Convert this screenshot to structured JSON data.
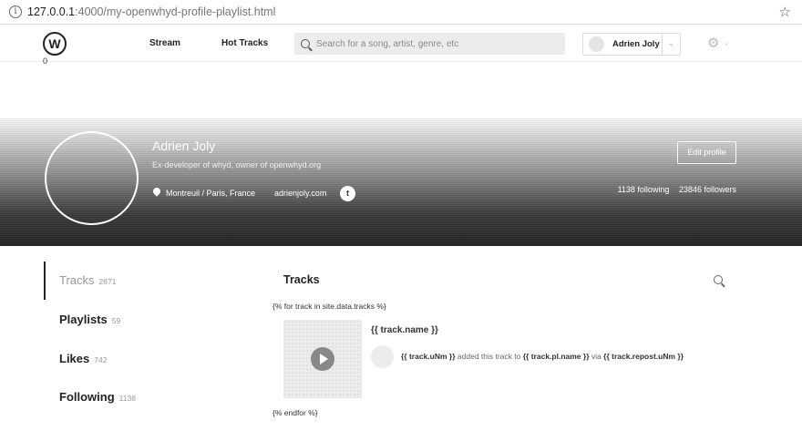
{
  "browser": {
    "info_icon": "i",
    "url_host": "127.0.0.1",
    "url_rest": ":4000/my-openwhyd-profile-playlist.html",
    "star_icon": "star-icon"
  },
  "header": {
    "logo_letter": "W",
    "logo_count": "0",
    "nav": {
      "stream": "Stream",
      "hot_tracks": "Hot Tracks"
    },
    "search_placeholder": "Search for a song, artist, genre, etc",
    "user_name": "Adrien Joly"
  },
  "profile": {
    "name": "Adrien Joly",
    "bio": "Ex-developer of whyd, owner of openwhyd.org",
    "location": "Montreuil / Paris, France",
    "website": "adrienjoly.com",
    "edit_label": "Edit profile",
    "following": "1138 following",
    "followers": "23846 followers"
  },
  "sidebar": {
    "items": [
      {
        "label": "Tracks",
        "count": "2871"
      },
      {
        "label": "Playlists",
        "count": "59"
      },
      {
        "label": "Likes",
        "count": "742"
      },
      {
        "label": "Following",
        "count": "1138"
      }
    ]
  },
  "main": {
    "title": "Tracks",
    "loop_start": "{% for track in site.data.tracks %}",
    "loop_end": "{% endfor %}",
    "track": {
      "name": "{{ track.name }}",
      "user": "{{ track.uNm }}",
      "mid": "added this track to",
      "playlist": "{{ track.pl.name }}",
      "via": "via",
      "repost": "{{ track.repost.uNm }}"
    }
  },
  "colors": {
    "text": "#222222",
    "muted": "#999999",
    "search_bg": "#ececec"
  }
}
